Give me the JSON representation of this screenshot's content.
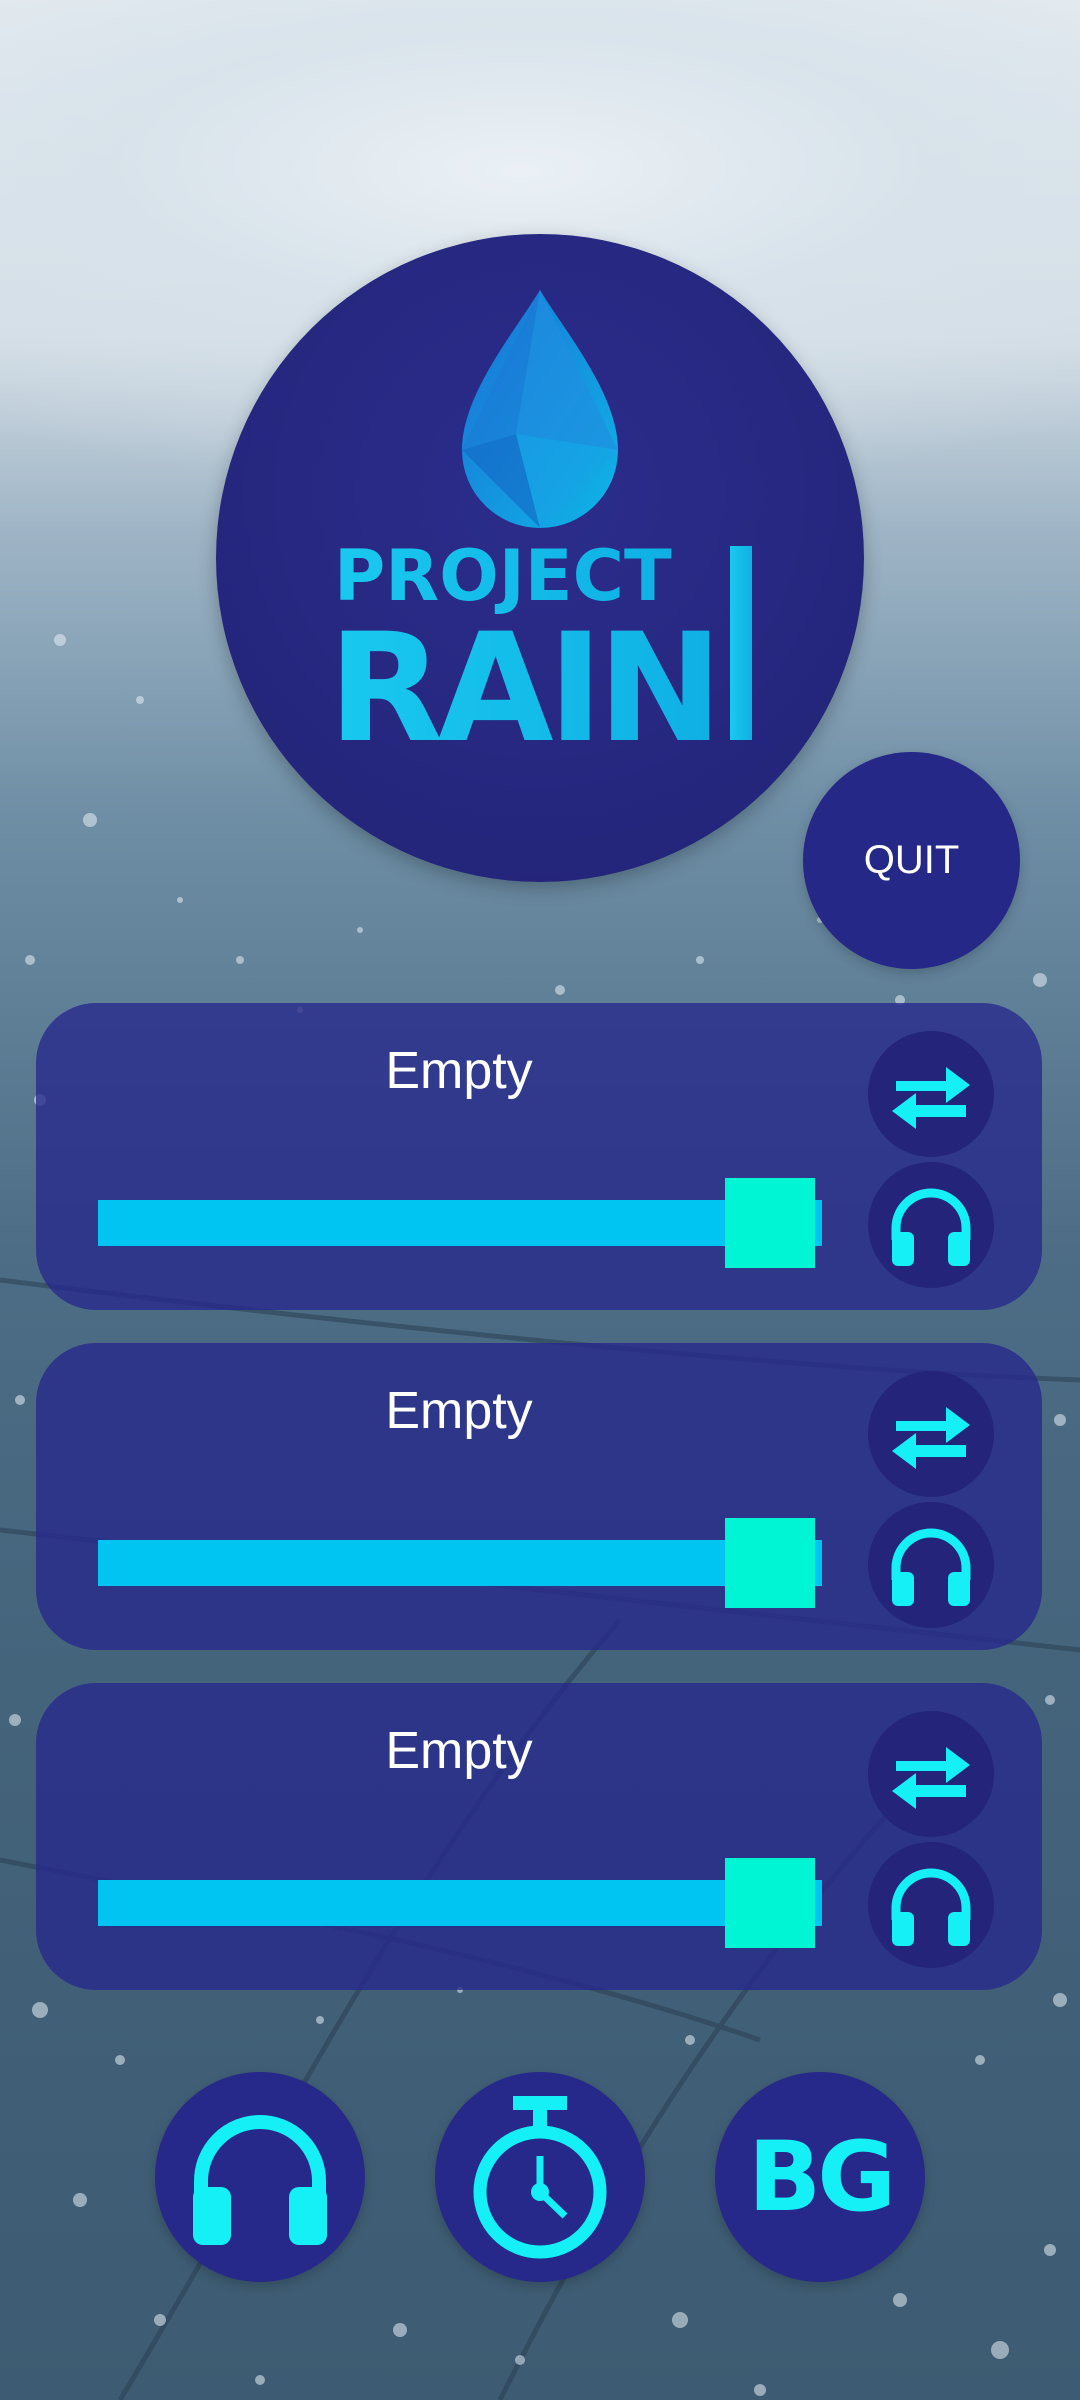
{
  "app": {
    "logo_line1": "PROJECT",
    "logo_line2": "RAIN",
    "quit_label": "QUIT"
  },
  "colors": {
    "panel": "#26288c",
    "button": "#23247a",
    "accent": "#14f0f5",
    "track": "#00c4f2",
    "thumb": "#00f5d4"
  },
  "channels": [
    {
      "label": "Empty",
      "volume": 1.0,
      "swap_icon": "swap-arrows-icon",
      "listen_icon": "headphones-icon"
    },
    {
      "label": "Empty",
      "volume": 1.0,
      "swap_icon": "swap-arrows-icon",
      "listen_icon": "headphones-icon"
    },
    {
      "label": "Empty",
      "volume": 1.0,
      "swap_icon": "swap-arrows-icon",
      "listen_icon": "headphones-icon"
    }
  ],
  "bottom_bar": {
    "sounds_icon": "headphones-icon",
    "timer_icon": "stopwatch-icon",
    "background_label": "BG"
  }
}
